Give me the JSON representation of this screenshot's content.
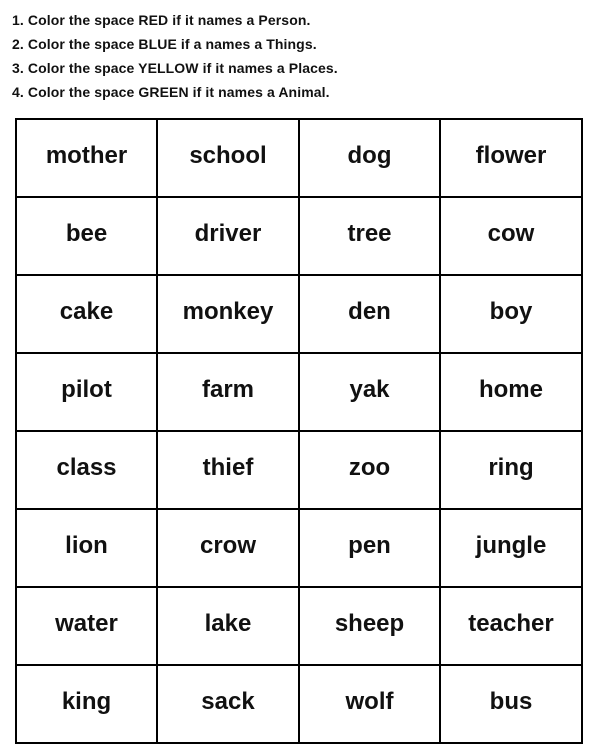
{
  "instructions": [
    "1. Color the space RED if it names a Person.",
    "2. Color the space BLUE if a names a Things.",
    "3. Color the space YELLOW if it names a Places.",
    "4. Color the space GREEN if it names a Animal."
  ],
  "color_key": {
    "Person": {
      "label": "RED",
      "hex": "#ff0000"
    },
    "Things": {
      "label": "BLUE",
      "hex": "#0000ff"
    },
    "Places": {
      "label": "YELLOW",
      "hex": "#ffff00"
    },
    "Animal": {
      "label": "GREEN",
      "hex": "#00a000"
    }
  },
  "grid": {
    "rows": [
      [
        "mother",
        "school",
        "dog",
        "flower"
      ],
      [
        "bee",
        "driver",
        "tree",
        "cow"
      ],
      [
        "cake",
        "monkey",
        "den",
        "boy"
      ],
      [
        "pilot",
        "farm",
        "yak",
        "home"
      ],
      [
        "class",
        "thief",
        "zoo",
        "ring"
      ],
      [
        "lion",
        "crow",
        "pen",
        "jungle"
      ],
      [
        "water",
        "lake",
        "sheep",
        "teacher"
      ],
      [
        "king",
        "sack",
        "wolf",
        "bus"
      ]
    ]
  }
}
